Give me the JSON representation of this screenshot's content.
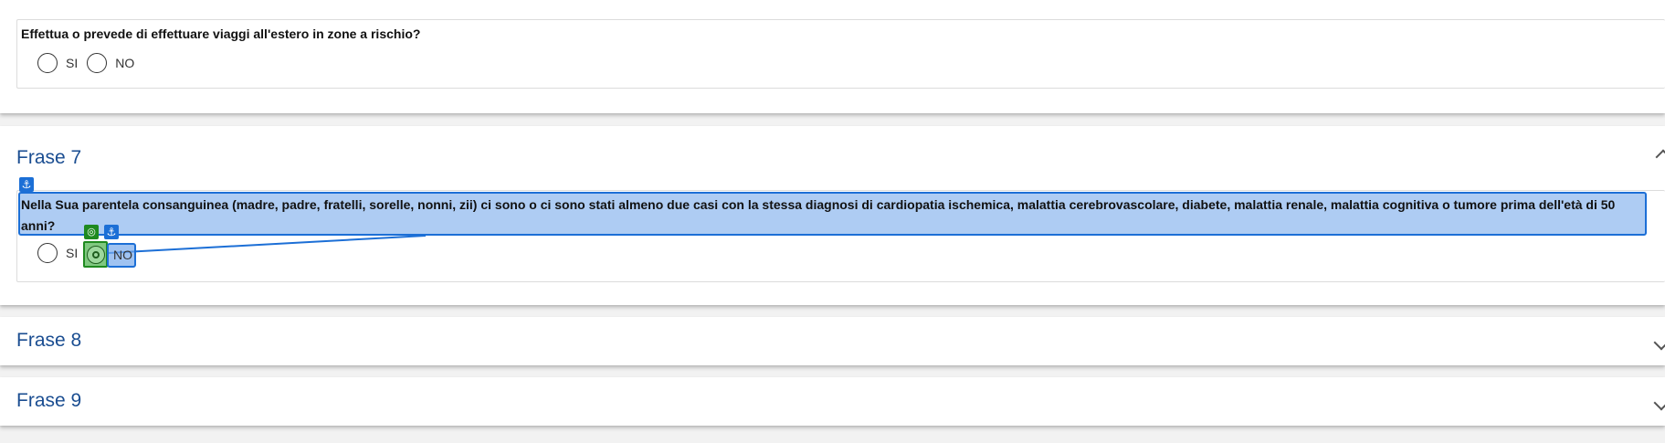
{
  "question_travel": {
    "text": "Effettua o prevede di effettuare viaggi all'estero in zone a rischio?",
    "options": {
      "si": "SI",
      "no": "NO"
    }
  },
  "frase7": {
    "title": "Frase 7",
    "question": "Nella Sua parentela consanguinea (madre, padre, fratelli, sorelle, nonni, zii) ci sono o ci sono stati almeno due casi con la stessa diagnosi di cardiopatia ischemica, malattia cerebrovascolare, diabete, malattia renale, malattia cognitiva o tumore prima dell'età di 50 anni?",
    "options": {
      "si": "SI",
      "no": "NO"
    }
  },
  "frase8": {
    "title": "Frase 8"
  },
  "frase9": {
    "title": "Frase 9"
  },
  "overlay": {
    "anchor_icon": "⚓",
    "target_icon": "◎"
  },
  "colors": {
    "title_blue": "#1a4d91",
    "highlight_blue": "#1c6fd6",
    "target_green": "#1f8a1f"
  }
}
